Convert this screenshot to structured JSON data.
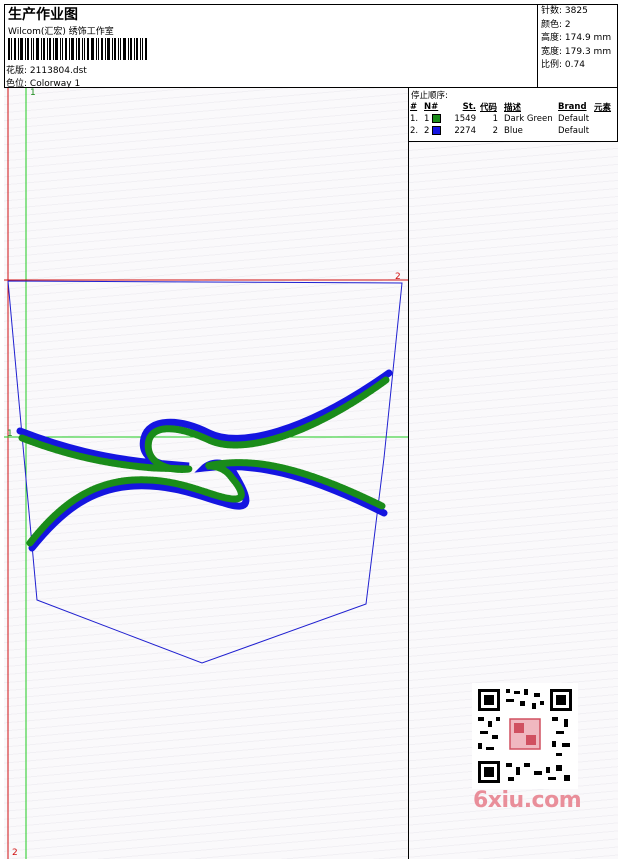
{
  "header": {
    "title": "生产作业图",
    "studio": "Wilcom(汇宏) 绣饰工作室",
    "design_label": "花版:",
    "design_value": "2113804.dst",
    "colorway_label": "色位:",
    "colorway_value": "Colorway 1"
  },
  "stats": {
    "stitches_label": "针数:",
    "stitches_value": "3825",
    "colors_label": "颜色:",
    "colors_value": "2",
    "height_label": "高度:",
    "height_value": "174.9 mm",
    "width_label": "宽度:",
    "width_value": "179.3 mm",
    "scale_label": "比例:",
    "scale_value": "0.74"
  },
  "stop_sequence": {
    "title": "停止顺序:",
    "columns": [
      "#",
      "N#",
      "St.",
      "代码",
      "描述",
      "Brand",
      "元素"
    ],
    "rows": [
      {
        "idx": "1.",
        "n": "1",
        "color": "#1a8c1a",
        "st": "1549",
        "code": "1",
        "desc": "Dark Green",
        "brand": "Default"
      },
      {
        "idx": "2.",
        "n": "2",
        "color": "#1515e0",
        "st": "2274",
        "code": "2",
        "desc": "Blue",
        "brand": "Default"
      }
    ]
  },
  "guides": {
    "v1_top": "1",
    "v2_bottom": "2",
    "h1_left": "1",
    "h2_right": "2"
  },
  "watermark": "6xiu.com",
  "colors": {
    "green_thread": "#1a8c1a",
    "blue_thread": "#1515e0",
    "red_guide": "#d01010",
    "green_guide": "#1fcc1f",
    "outline": "#2020d0"
  }
}
